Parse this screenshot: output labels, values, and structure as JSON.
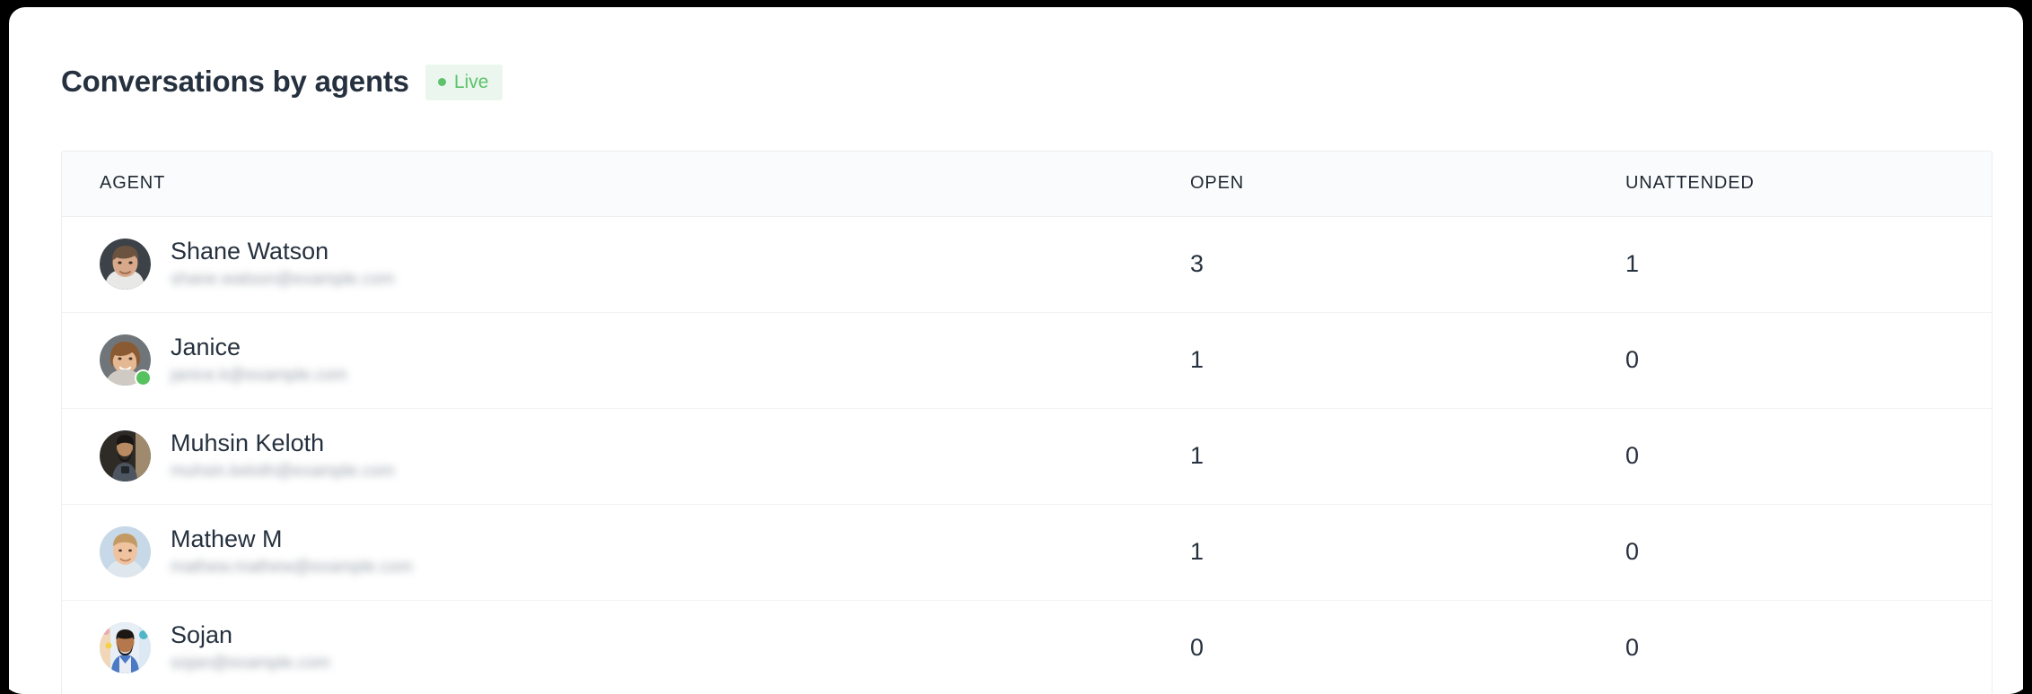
{
  "panel": {
    "title": "Conversations by agents",
    "badge": {
      "label": "Live",
      "dot_icon": "status-dot-icon",
      "bg_color": "#ebf7ee",
      "text_color": "#5cc26b"
    }
  },
  "table": {
    "columns": [
      {
        "key": "agent",
        "label": "AGENT",
        "align": "left"
      },
      {
        "key": "open",
        "label": "OPEN",
        "align": "left"
      },
      {
        "key": "unattended",
        "label": "UNATTENDED",
        "align": "left"
      }
    ],
    "rows": [
      {
        "name": "Shane Watson",
        "email": "shane.watson@example.com",
        "online": false,
        "open": "3",
        "unattended": "1",
        "avatar_icon": "avatar-photo-shane-watson"
      },
      {
        "name": "Janice",
        "email": "janice.k@example.com",
        "online": true,
        "open": "1",
        "unattended": "0",
        "avatar_icon": "avatar-photo-janice"
      },
      {
        "name": "Muhsin Keloth",
        "email": "muhsin.keloth@example.com",
        "online": false,
        "open": "1",
        "unattended": "0",
        "avatar_icon": "avatar-photo-muhsin-keloth"
      },
      {
        "name": "Mathew M",
        "email": "mathew.mathew@example.com",
        "online": false,
        "open": "1",
        "unattended": "0",
        "avatar_icon": "avatar-photo-mathew-m"
      },
      {
        "name": "Sojan",
        "email": "sojan@example.com",
        "online": false,
        "open": "0",
        "unattended": "0",
        "avatar_icon": "avatar-photo-sojan"
      }
    ]
  },
  "colors": {
    "accent_green": "#5cc26b",
    "title": "#26313f",
    "header_bg": "#fafbfc",
    "border": "#eceef1",
    "frame": "#000000"
  }
}
